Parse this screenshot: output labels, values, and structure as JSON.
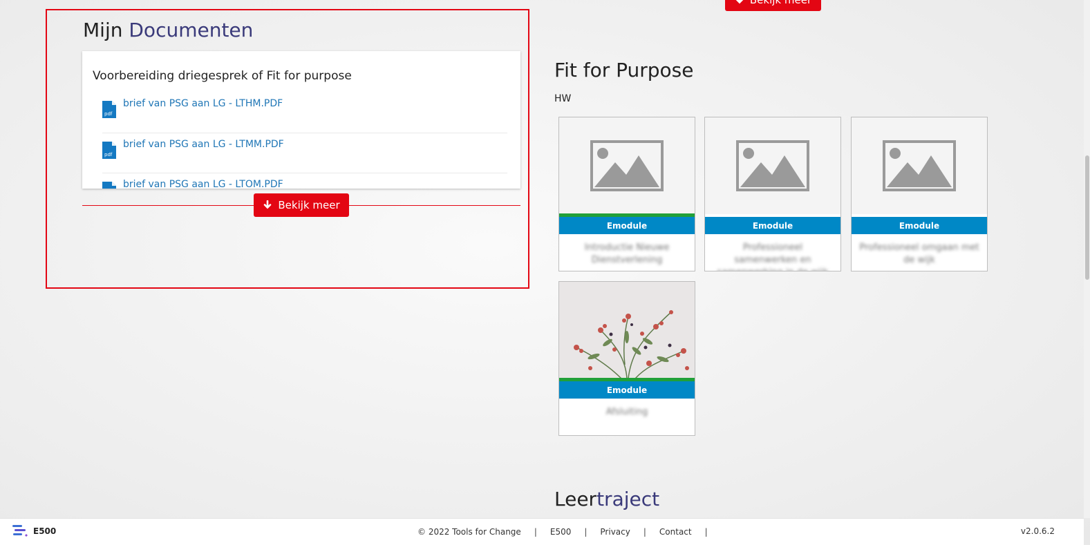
{
  "top_more_label": "Bekijk meer",
  "documents": {
    "title_prefix": "Mijn",
    "title_accent": "Documenten",
    "group_title": "Voorbereiding driegesprek  of  Fit for purpose",
    "files": [
      {
        "name": "brief van PSG aan LG - LTHM.PDF",
        "icon": "pdf"
      },
      {
        "name": "brief van PSG aan LG - LTMM.PDF",
        "icon": "pdf"
      },
      {
        "name": "brief van PSG aan LG - LTOM.PDF",
        "icon": "pdf"
      }
    ],
    "more_label": "Bekijk meer"
  },
  "fit_for_purpose": {
    "title": "Fit for Purpose",
    "subtitle": "HW",
    "cards": [
      {
        "type_label": "Emodule",
        "caption": "Introductie Nieuwe Dienstverlening",
        "thumbnail": "placeholder-image-icon",
        "progress": 1.0
      },
      {
        "type_label": "Emodule",
        "caption": "Professioneel samenwerken en samenwerking in de wijk",
        "thumbnail": "placeholder-image-icon",
        "progress": 0
      },
      {
        "type_label": "Emodule",
        "caption": "Professioneel omgaan met de wijk",
        "thumbnail": "placeholder-image-icon",
        "progress": 0
      },
      {
        "type_label": "Emodule",
        "caption": "Afsluiting",
        "thumbnail": "flowers-photo",
        "progress": 1.0
      }
    ]
  },
  "leertraject": {
    "title_prefix": "Leer",
    "title_accent": "traject"
  },
  "footer": {
    "logo_text": "E500",
    "copyright": "© 2022 Tools for Change",
    "links": [
      "E500",
      "Privacy",
      "Contact"
    ],
    "version": "v2.0.6.2"
  },
  "colors": {
    "brand_red": "#e30613",
    "link_blue": "#1f76b6",
    "module_blue": "#0088c6",
    "progress_green": "#21a038",
    "accent_navy": "#3a3a7a"
  }
}
